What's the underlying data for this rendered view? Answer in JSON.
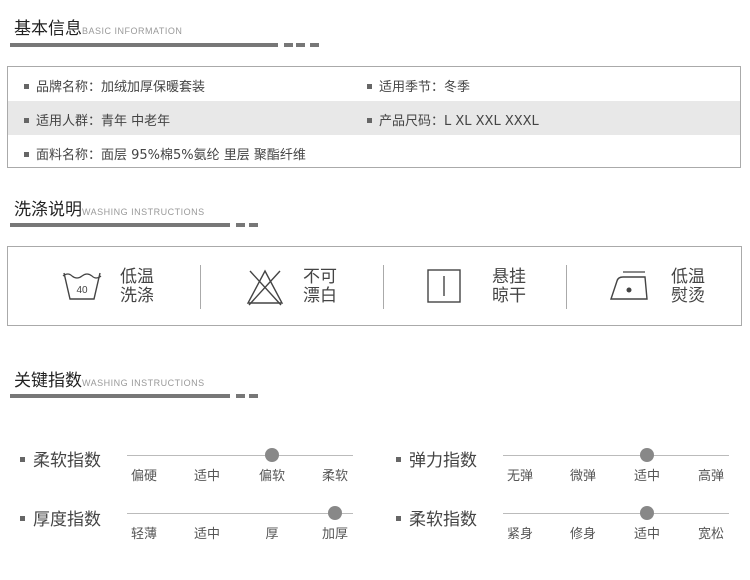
{
  "sections": {
    "basic": {
      "title": "基本信息",
      "subtitle": "BASIC INFORMATION"
    },
    "washing": {
      "title": "洗涤说明",
      "subtitle": "WASHING INSTRUCTIONS"
    },
    "index": {
      "title": "关键指数",
      "subtitle": "WASHING INSTRUCTIONS"
    }
  },
  "info": {
    "brand": "品牌名称：加绒加厚保暖套装",
    "season": "适用季节：冬季",
    "crowd": "适用人群：青年 中老年",
    "size": "产品尺码：L XL XXL XXXL",
    "fabric": "面料名称：面层 95%棉5%氨纶  里层 聚酯纤维"
  },
  "washing": [
    {
      "icon": "wash-40-icon",
      "temp": "40",
      "line1": "低温",
      "line2": "洗涤"
    },
    {
      "icon": "no-bleach-icon",
      "line1": "不可",
      "line2": "漂白"
    },
    {
      "icon": "hang-dry-icon",
      "line1": "悬挂",
      "line2": "晾干"
    },
    {
      "icon": "low-iron-icon",
      "line1": "低温",
      "line2": "熨烫"
    }
  ],
  "indices": [
    {
      "label": "柔软指数",
      "options": [
        "偏硬",
        "适中",
        "偏软",
        "柔软"
      ],
      "selected": 2
    },
    {
      "label": "弹力指数",
      "options": [
        "无弹",
        "微弹",
        "适中",
        "高弹"
      ],
      "selected": 2
    },
    {
      "label": "厚度指数",
      "options": [
        "轻薄",
        "适中",
        "厚",
        "加厚"
      ],
      "selected": 3
    },
    {
      "label": "柔软指数",
      "options": [
        "紧身",
        "修身",
        "适中",
        "宽松"
      ],
      "selected": 2
    }
  ],
  "colors": {
    "bar": "#777777",
    "row_alt": "#e8e8e8",
    "dot": "#888888"
  }
}
